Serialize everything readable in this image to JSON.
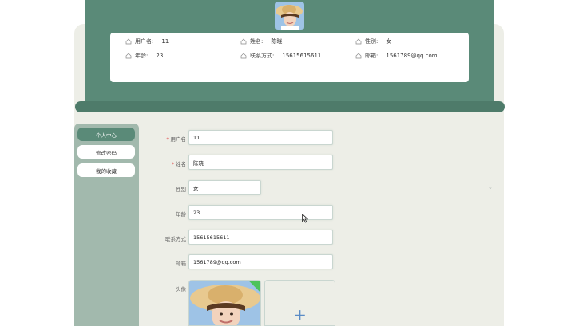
{
  "header": {
    "info": {
      "username_label": "用户名:",
      "username_value": "11",
      "name_label": "姓名:",
      "name_value": "陈晓",
      "gender_label": "性别:",
      "gender_value": "女",
      "age_label": "年龄:",
      "age_value": "23",
      "phone_label": "联系方式:",
      "phone_value": "15615615611",
      "email_label": "邮箱:",
      "email_value": "1561789@qq.com"
    }
  },
  "sidebar": {
    "items": [
      {
        "label": "个人中心",
        "active": true
      },
      {
        "label": "修改密码",
        "active": false
      },
      {
        "label": "我的收藏",
        "active": false
      }
    ]
  },
  "form": {
    "required_mark": "*",
    "username_label": "用户名",
    "username_value": "11",
    "name_label": "姓名",
    "name_value": "陈晓",
    "gender_label": "性别",
    "gender_value": "女",
    "age_label": "年龄",
    "age_value": "23",
    "phone_label": "联系方式",
    "phone_value": "15615615611",
    "email_label": "邮箱",
    "email_value": "1561789@qq.com",
    "avatar_label": "头像",
    "upload_plus": "+"
  },
  "theme": {
    "primary": "#5a8a78",
    "sidebar": "#a2b9ad",
    "background": "#edeee7",
    "required": "#e04a4a",
    "upload_plus": "#5a8bc6",
    "success": "#4cc35b"
  },
  "icons": [
    "user-icon",
    "chevron-down-icon",
    "plus-icon",
    "check-icon",
    "cursor-icon"
  ]
}
